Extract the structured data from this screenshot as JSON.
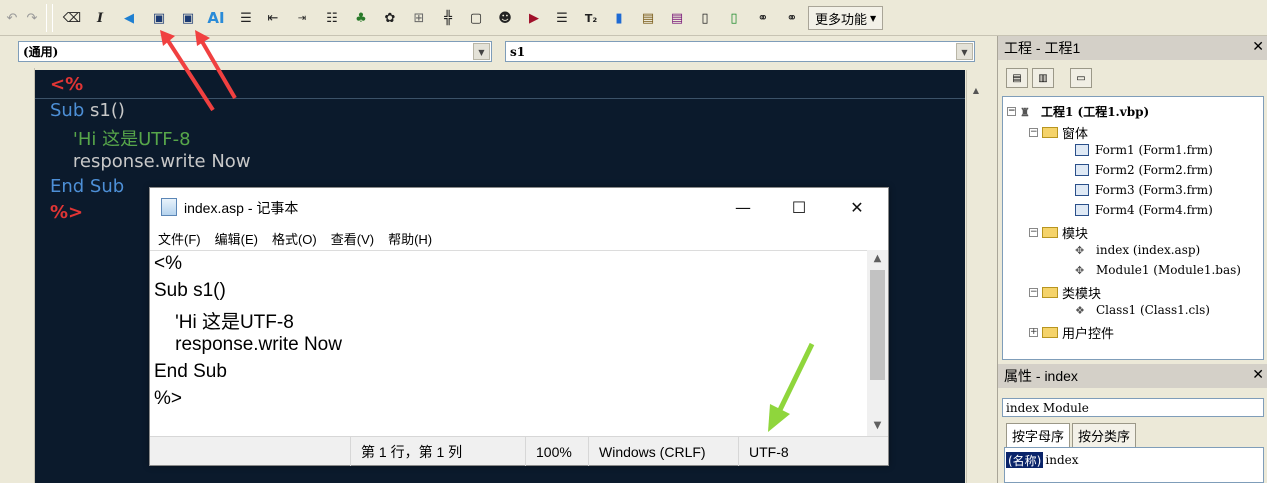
{
  "toolbar": {
    "more_label": "更多功能",
    "icons": [
      "undo-icon",
      "redo-icon",
      "eraser-icon",
      "italic-icon",
      "vscode-icon",
      "save-ansi-icon",
      "save-utf8-icon",
      "ai-icon",
      "align-icon",
      "outdent-icon",
      "indent-icon",
      "list-icon",
      "tree-icon",
      "fingerprint-icon",
      "grid-icon",
      "cross-grid-icon",
      "frame-icon",
      "head-icon",
      "run-icon",
      "toc-icon",
      "subscript-icon",
      "bookmark-icon",
      "image-edit-icon",
      "image-icon",
      "document-icon",
      "add-document-icon",
      "binoculars-icon",
      "binoculars-alt-icon"
    ]
  },
  "code_window": {
    "object_combo": "(通用)",
    "proc_combo": "s1",
    "lines": [
      {
        "t": "<%",
        "cls": "delim"
      },
      {
        "t": "Sub s1()",
        "cls": "mixed_sub"
      },
      {
        "t": "    'Hi 这是UTF-8",
        "cls": "cmt"
      },
      {
        "t": "    response.write Now",
        "cls": "plain"
      },
      {
        "t": "End Sub",
        "cls": "kw"
      },
      {
        "t": "%>",
        "cls": "delim"
      }
    ],
    "sub_kw": "Sub",
    "sub_name": " s1()"
  },
  "notepad": {
    "title": "index.asp - 记事本",
    "menu": [
      "文件(F)",
      "编辑(E)",
      "格式(O)",
      "查看(V)",
      "帮助(H)"
    ],
    "lines": [
      "<%",
      "Sub s1()",
      "    'Hi 这是UTF-8",
      "    response.write Now",
      "End Sub",
      "%>"
    ],
    "status": {
      "position": "第 1 行，第 1 列",
      "zoom": "100%",
      "eol": "Windows (CRLF)",
      "encoding": "UTF-8"
    },
    "controls": {
      "minimize": "—",
      "maximize": "☐",
      "close": "✕"
    }
  },
  "project": {
    "title": "工程 - 工程1",
    "root": "工程1 (工程1.vbp)",
    "folders": {
      "forms": "窗体",
      "modules": "模块",
      "classes": "类模块",
      "usercontrols": "用户控件"
    },
    "forms": [
      "Form1 (Form1.frm)",
      "Form2 (Form2.frm)",
      "Form3 (Form3.frm)",
      "Form4 (Form4.frm)"
    ],
    "modules": [
      "index (index.asp)",
      "Module1 (Module1.bas)"
    ],
    "classes": [
      "Class1 (Class1.cls)"
    ]
  },
  "properties": {
    "title": "属性 - index",
    "object": "index Module",
    "tabs": [
      "按字母序",
      "按分类序"
    ],
    "key": "(名称)",
    "value": "index"
  },
  "colors": {
    "editor_bg": "#0b1a2c",
    "keyword": "#4d8fd6",
    "comment": "#57a64a",
    "delimiter": "#e03535",
    "annotation_red": "#f04040",
    "annotation_green": "#8fd63c"
  }
}
